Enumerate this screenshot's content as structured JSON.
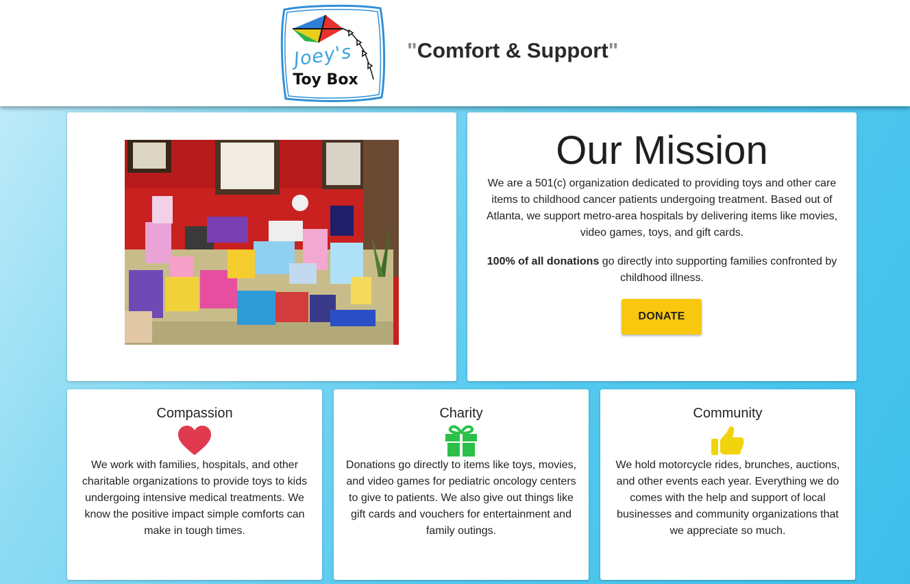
{
  "header": {
    "logo": {
      "line1": "Joey's",
      "line2": "Toy Box"
    },
    "tagline": "Comfort & Support",
    "quote_mark": "\""
  },
  "photo": {
    "icon": "toys-photo"
  },
  "mission": {
    "title": "Our Mission",
    "paragraph1": "We are a 501(c) organization dedicated to providing toys and other care items to childhood cancer patients undergoing treatment. Based out of Atlanta, we support metro-area hospitals by delivering items like movies, video games, toys, and gift cards.",
    "paragraph2_bold": "100% of all donations",
    "paragraph2_rest": " go directly into supporting families confronted by childhood illness.",
    "donate_label": "DONATE"
  },
  "values": [
    {
      "title": "Compassion",
      "icon": "heart-icon",
      "color": "#e03a4e",
      "text": "We work with families, hospitals, and other charitable organizations to provide toys to kids undergoing intensive medical treatments. We know the positive impact simple comforts can make in tough times."
    },
    {
      "title": "Charity",
      "icon": "gift-icon",
      "color": "#2cc04a",
      "text": "Donations go directly to items like toys, movies, and video games for pediatric oncology centers to give to patients. We also give out things like gift cards and vouchers for entertainment and family outings."
    },
    {
      "title": "Community",
      "icon": "thumbs-up-icon",
      "color": "#f2d40c",
      "text": "We hold motorcycle rides, brunches, auctions, and other events each year. Everything we do comes with the help and support of local businesses and community organizations that we appreciate so much."
    }
  ],
  "colors": {
    "accent": "#f9c80e",
    "logo_blue": "#3aa3dc",
    "photo_wall": "#c9211f"
  }
}
